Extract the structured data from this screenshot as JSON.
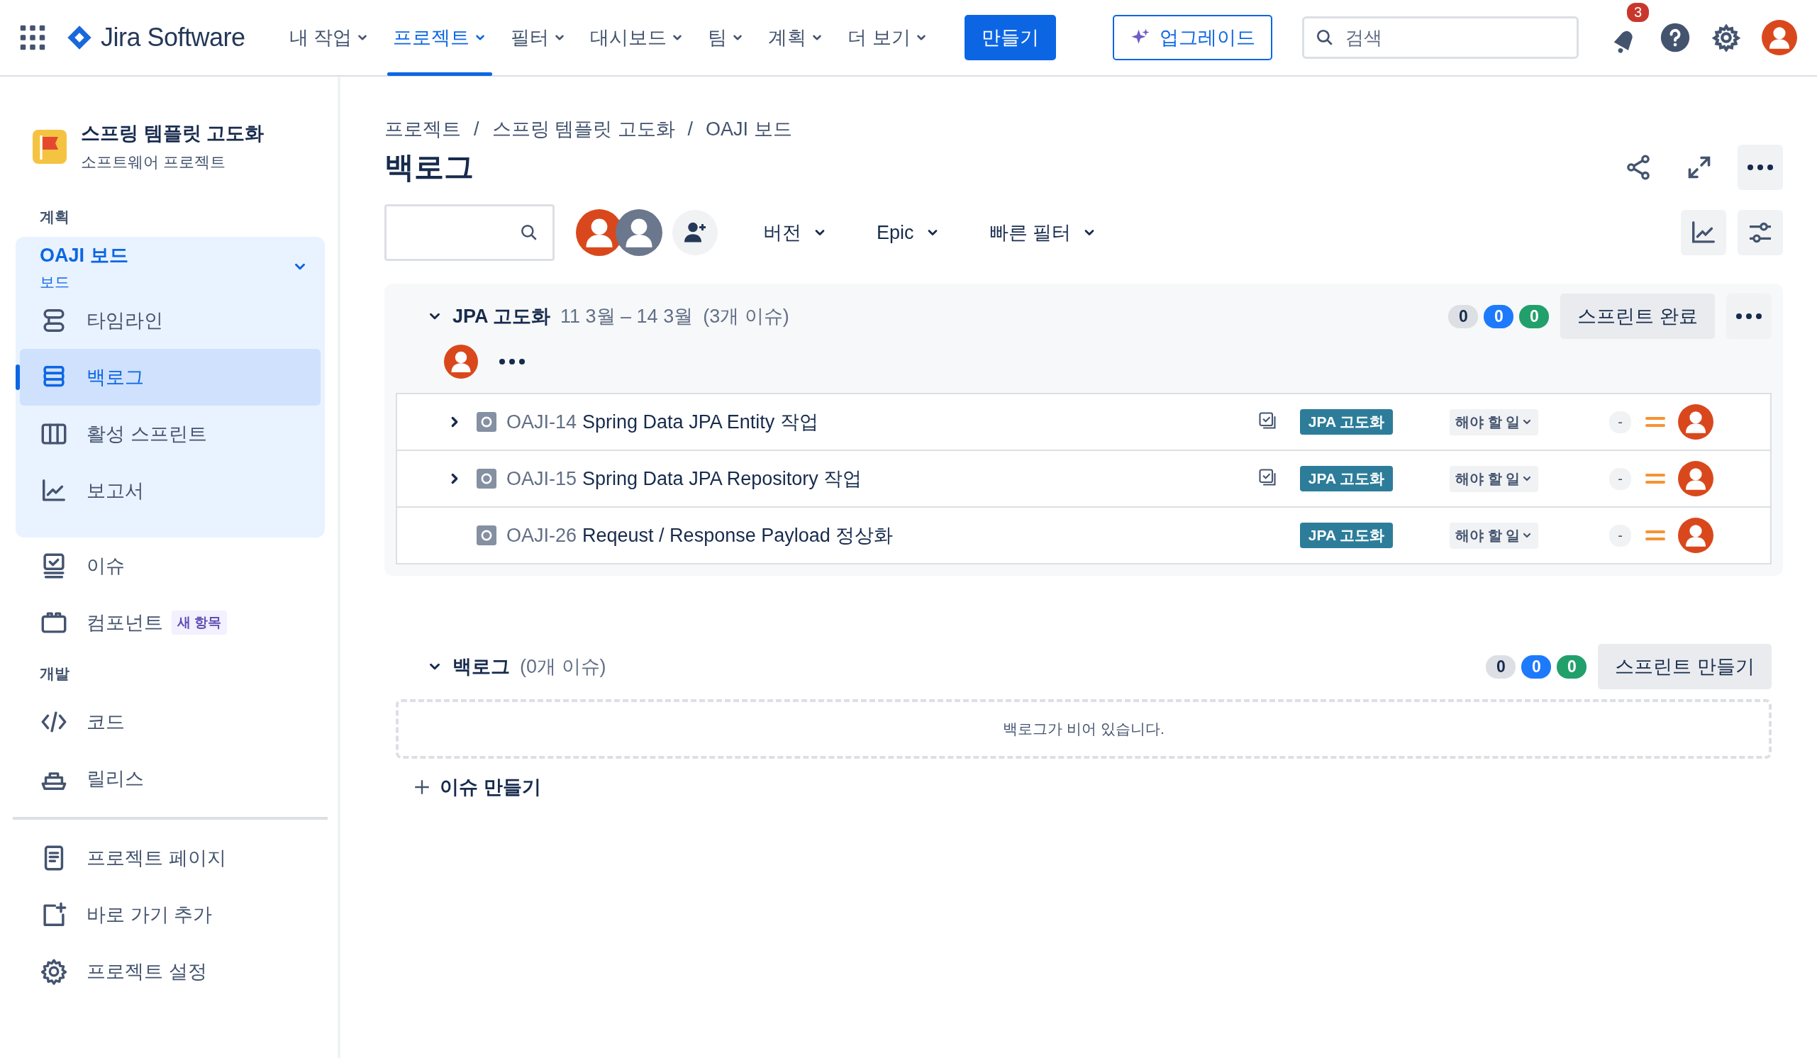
{
  "nav": {
    "product": "Jira Software",
    "items": [
      {
        "label": "내 작업",
        "selected": false
      },
      {
        "label": "프로젝트",
        "selected": true
      },
      {
        "label": "필터",
        "selected": false
      },
      {
        "label": "대시보드",
        "selected": false
      },
      {
        "label": "팀",
        "selected": false
      },
      {
        "label": "계획",
        "selected": false
      },
      {
        "label": "더 보기",
        "selected": false
      }
    ],
    "create": "만들기",
    "upgrade": "업그레이드",
    "search": {
      "placeholder": "검색"
    },
    "notifications": "3"
  },
  "sidebar": {
    "project": {
      "name": "스프링 템플릿 고도화",
      "type": "소프트웨어 프로젝트"
    },
    "sections": [
      {
        "title": "계획",
        "board": {
          "title": "OAJI 보드",
          "subtitle": "보드",
          "expanded": true,
          "items": [
            {
              "label": "타임라인",
              "selected": false
            },
            {
              "label": "백로그",
              "selected": true
            },
            {
              "label": "활성 스프린트",
              "selected": false
            },
            {
              "label": "보고서",
              "selected": false
            }
          ]
        },
        "items": [
          {
            "label": "이슈"
          },
          {
            "label": "컴포넌트",
            "badge": "새 항목"
          }
        ]
      },
      {
        "title": "개발",
        "items": [
          {
            "label": "코드"
          },
          {
            "label": "릴리스"
          }
        ]
      }
    ],
    "footer": [
      {
        "label": "프로젝트 페이지"
      },
      {
        "label": "바로 가기 추가"
      },
      {
        "label": "프로젝트 설정"
      }
    ]
  },
  "breadcrumbs": [
    "프로젝트",
    "스프링 템플릿 고도화",
    "OAJI 보드"
  ],
  "breadcrumb_separator": "/",
  "title": "백로그",
  "filters": [
    "버전",
    "Epic",
    "빠른 필터"
  ],
  "sprint": {
    "name": "JPA 고도화",
    "dates": "11 3월 – 14 3월",
    "count": "(3개 이슈)",
    "expanded": true,
    "counts": [
      "0",
      "0",
      "0"
    ],
    "button": "스프린트 완료",
    "issues": [
      {
        "key": "OAJI-14",
        "summary": "Spring Data JPA Entity 작업",
        "has_children": true,
        "epic": "JPA 고도화",
        "status": "해야 할 일",
        "estimate": "-"
      },
      {
        "key": "OAJI-15",
        "summary": "Spring Data JPA Repository 작업",
        "has_children": true,
        "epic": "JPA 고도화",
        "status": "해야 할 일",
        "estimate": "-"
      },
      {
        "key": "OAJI-26",
        "summary": "Reqeust / Response Payload 정상화",
        "has_children": false,
        "epic": "JPA 고도화",
        "status": "해야 할 일",
        "estimate": "-"
      }
    ]
  },
  "backlog": {
    "title": "백로그",
    "count": "(0개 이슈)",
    "expanded": true,
    "counts": [
      "0",
      "0",
      "0"
    ],
    "button": "스프린트 만들기",
    "empty": "백로그가 비어 있습니다.",
    "create": "이슈 만들기"
  }
}
